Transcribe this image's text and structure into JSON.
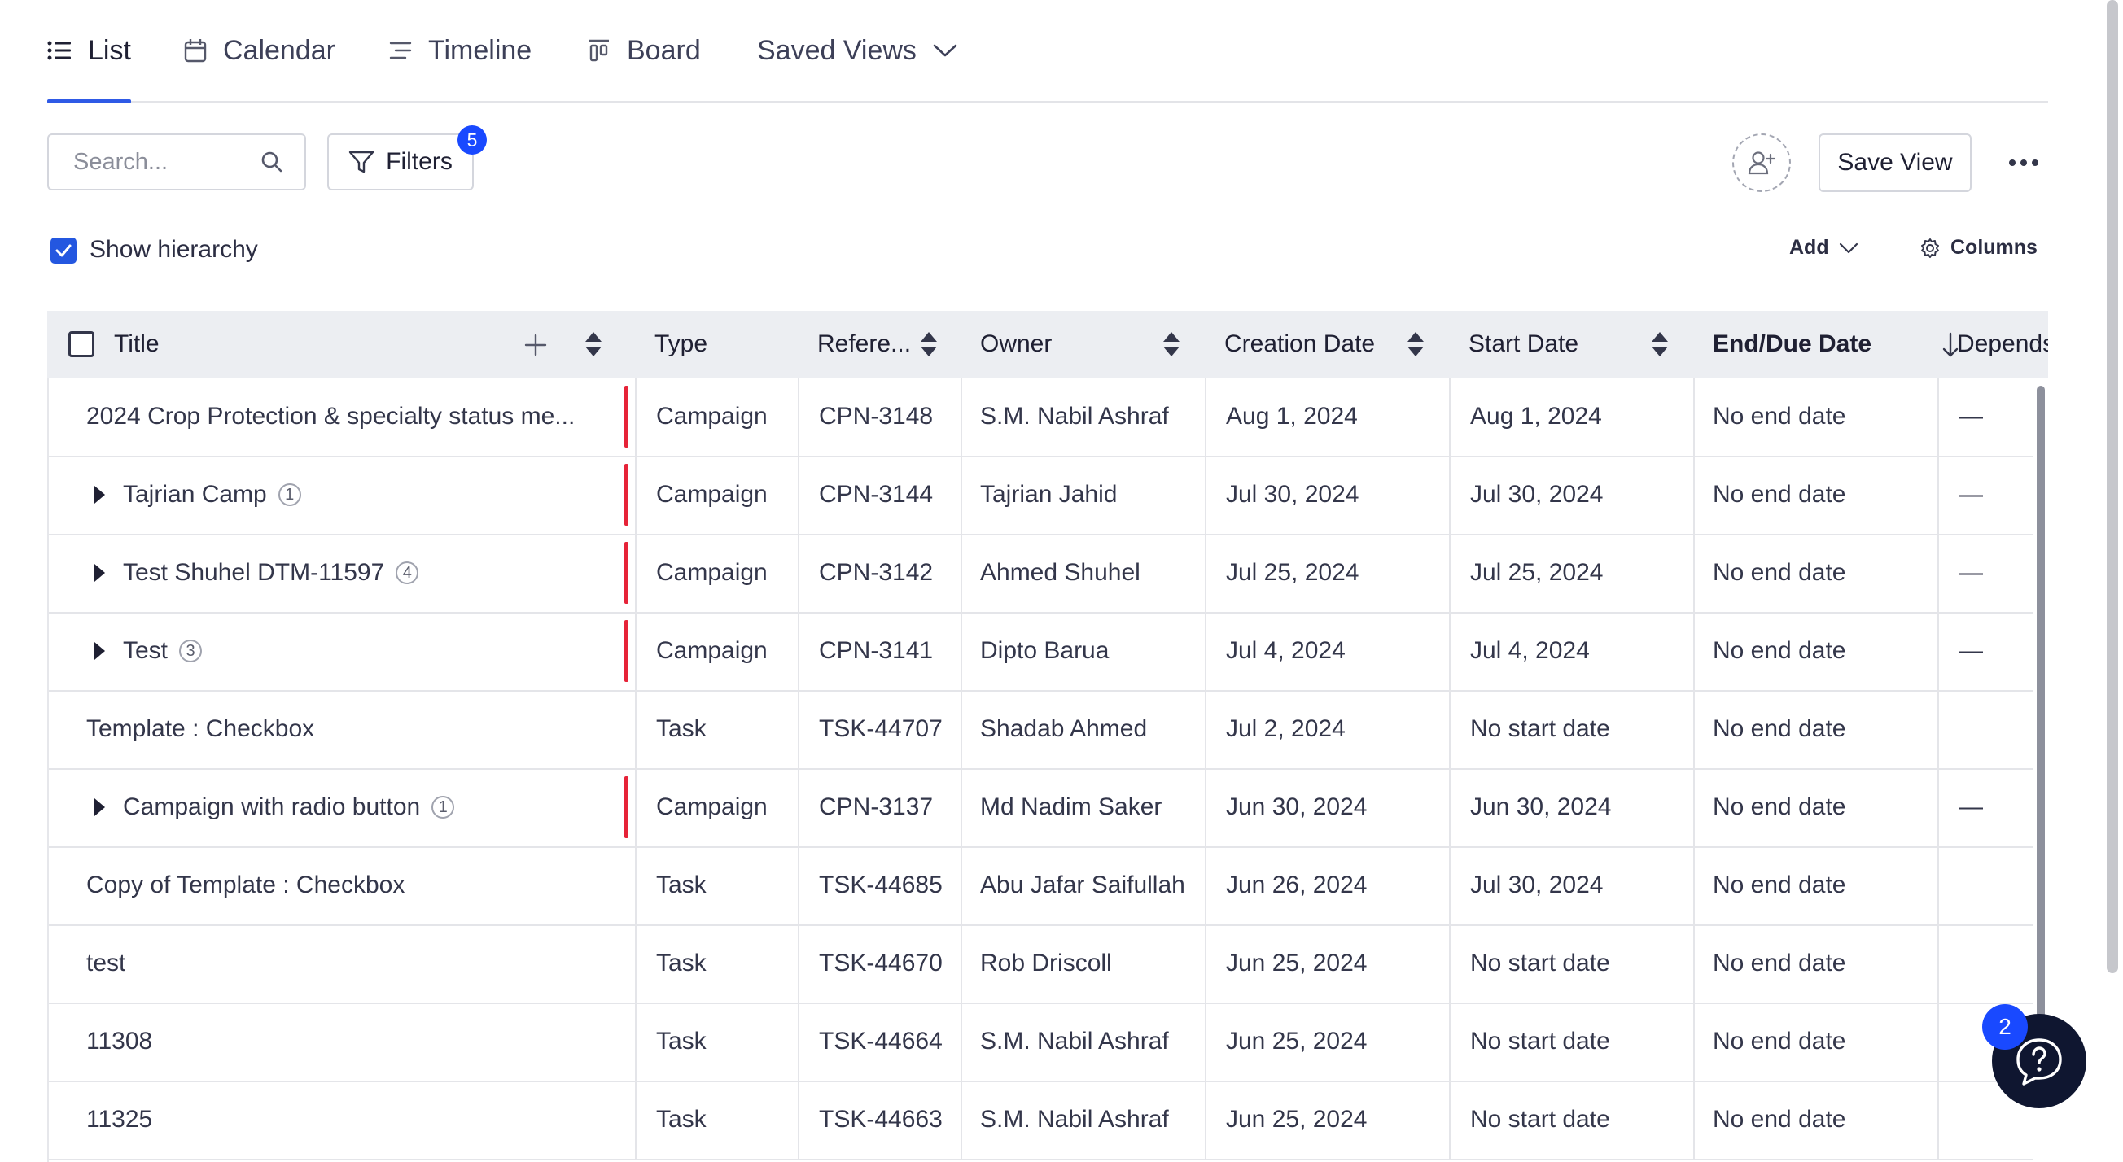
{
  "tabs": [
    {
      "label": "List",
      "icon": "list-icon",
      "active": true
    },
    {
      "label": "Calendar",
      "icon": "calendar-icon"
    },
    {
      "label": "Timeline",
      "icon": "timeline-icon"
    },
    {
      "label": "Board",
      "icon": "board-icon"
    },
    {
      "label": "Saved Views",
      "icon": "chevron-down-icon"
    }
  ],
  "toolbar": {
    "search_placeholder": "Search...",
    "filters_label": "Filters",
    "filters_count": "5",
    "save_view_label": "Save View"
  },
  "options": {
    "show_hierarchy_label": "Show hierarchy",
    "show_hierarchy_checked": true,
    "add_label": "Add",
    "columns_label": "Columns"
  },
  "table": {
    "headers": {
      "title": "Title",
      "type": "Type",
      "reference": "Refere...",
      "owner": "Owner",
      "creation_date": "Creation Date",
      "start_date": "Start Date",
      "end_date": "End/Due Date",
      "depends": "Depends"
    },
    "rows": [
      {
        "title": "2024 Crop Protection & specialty status me...",
        "expandable": false,
        "count": "",
        "campaign": true,
        "type": "Campaign",
        "reference": "CPN-3148",
        "owner": "S.M. Nabil Ashraf",
        "creation_date": "Aug 1, 2024",
        "start_date": "Aug 1, 2024",
        "end_date": "No end date",
        "depends": "—"
      },
      {
        "title": "Tajrian Camp",
        "expandable": true,
        "count": "1",
        "campaign": true,
        "type": "Campaign",
        "reference": "CPN-3144",
        "owner": "Tajrian Jahid",
        "creation_date": "Jul 30, 2024",
        "start_date": "Jul 30, 2024",
        "end_date": "No end date",
        "depends": "—"
      },
      {
        "title": "Test Shuhel DTM-11597",
        "expandable": true,
        "count": "4",
        "campaign": true,
        "type": "Campaign",
        "reference": "CPN-3142",
        "owner": "Ahmed Shuhel",
        "creation_date": "Jul 25, 2024",
        "start_date": "Jul 25, 2024",
        "end_date": "No end date",
        "depends": "—"
      },
      {
        "title": "Test",
        "expandable": true,
        "count": "3",
        "campaign": true,
        "type": "Campaign",
        "reference": "CPN-3141",
        "owner": "Dipto Barua",
        "creation_date": "Jul 4, 2024",
        "start_date": "Jul 4, 2024",
        "end_date": "No end date",
        "depends": "—"
      },
      {
        "title": "Template : Checkbox",
        "expandable": false,
        "count": "",
        "campaign": false,
        "type": "Task",
        "reference": "TSK-44707",
        "owner": "Shadab Ahmed",
        "creation_date": "Jul 2, 2024",
        "start_date": "No start date",
        "end_date": "No end date",
        "depends": ""
      },
      {
        "title": "Campaign with radio button",
        "expandable": true,
        "count": "1",
        "campaign": true,
        "type": "Campaign",
        "reference": "CPN-3137",
        "owner": "Md Nadim Saker",
        "creation_date": "Jun 30, 2024",
        "start_date": "Jun 30, 2024",
        "end_date": "No end date",
        "depends": "—"
      },
      {
        "title": "Copy of Template : Checkbox",
        "expandable": false,
        "count": "",
        "campaign": false,
        "type": "Task",
        "reference": "TSK-44685",
        "owner": "Abu Jafar Saifullah",
        "creation_date": "Jun 26, 2024",
        "start_date": "Jul 30, 2024",
        "end_date": "No end date",
        "depends": ""
      },
      {
        "title": "test",
        "expandable": false,
        "count": "",
        "campaign": false,
        "type": "Task",
        "reference": "TSK-44670",
        "owner": "Rob Driscoll",
        "creation_date": "Jun 25, 2024",
        "start_date": "No start date",
        "end_date": "No end date",
        "depends": ""
      },
      {
        "title": "11308",
        "expandable": false,
        "count": "",
        "campaign": false,
        "type": "Task",
        "reference": "TSK-44664",
        "owner": "S.M. Nabil Ashraf",
        "creation_date": "Jun 25, 2024",
        "start_date": "No start date",
        "end_date": "No end date",
        "depends": ""
      },
      {
        "title": "11325",
        "expandable": false,
        "count": "",
        "campaign": false,
        "type": "Task",
        "reference": "TSK-44663",
        "owner": "S.M. Nabil Ashraf",
        "creation_date": "Jun 25, 2024",
        "start_date": "No start date",
        "end_date": "No end date",
        "depends": ""
      }
    ]
  },
  "help": {
    "badge_count": "2",
    "icon": "help-icon"
  },
  "colors": {
    "accent": "#2f5ae6",
    "badge": "#1949ff",
    "campaign_marker": "#e62338",
    "help_bg": "#0f1630"
  }
}
